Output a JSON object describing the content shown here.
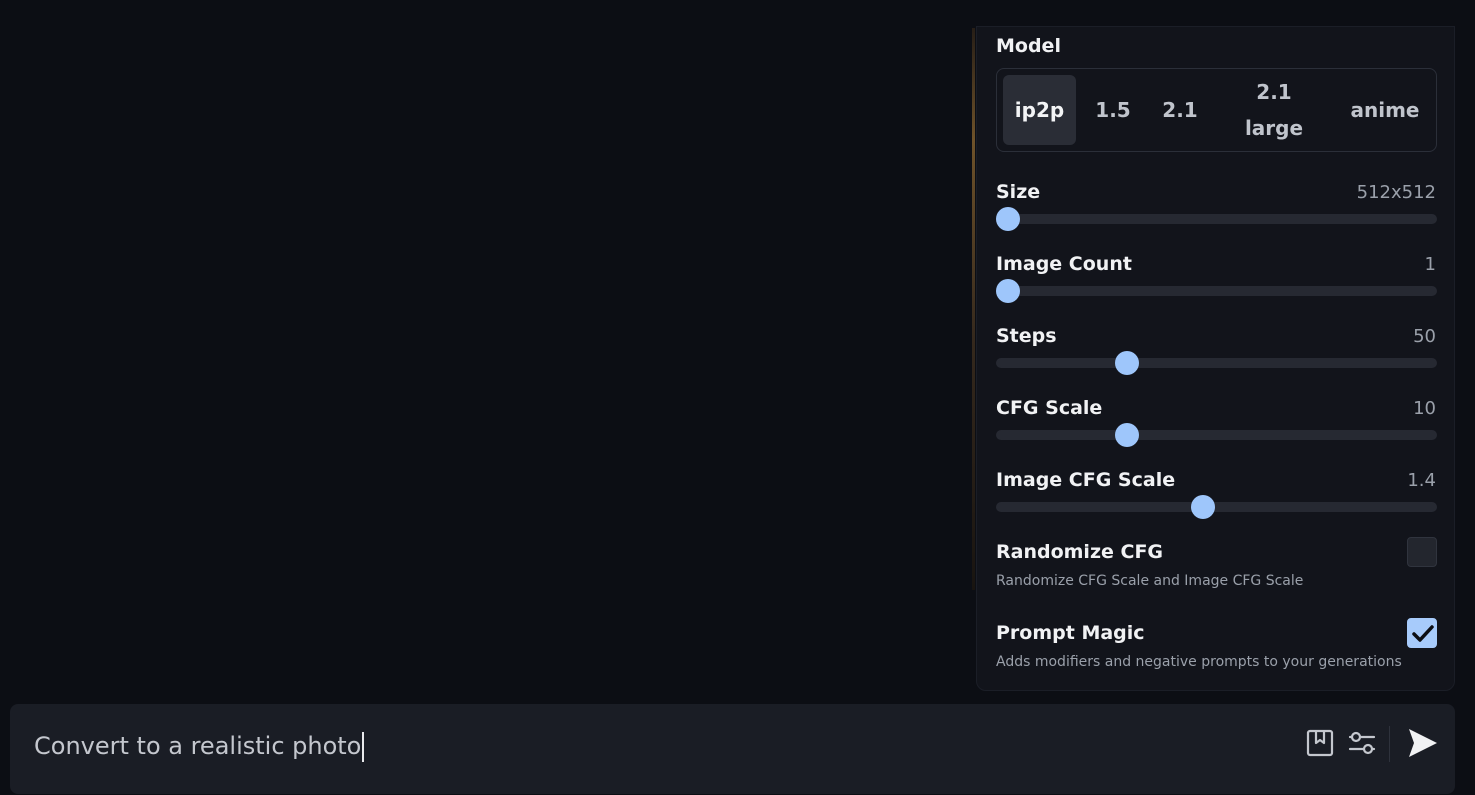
{
  "model": {
    "label": "Model",
    "options": [
      "ip2p",
      "1.5",
      "2.1",
      "2.1 large",
      "anime"
    ],
    "selected": "ip2p"
  },
  "sliders": {
    "size": {
      "label": "Size",
      "value": "512x512",
      "fraction": 0.027
    },
    "image_count": {
      "label": "Image Count",
      "value": "1",
      "fraction": 0.027
    },
    "steps": {
      "label": "Steps",
      "value": "50",
      "fraction": 0.297
    },
    "cfg_scale": {
      "label": "CFG Scale",
      "value": "10",
      "fraction": 0.297
    },
    "image_cfg_scale": {
      "label": "Image CFG Scale",
      "value": "1.4",
      "fraction": 0.469
    }
  },
  "randomize_cfg": {
    "label": "Randomize CFG",
    "description": "Randomize CFG Scale and Image CFG Scale",
    "checked": false
  },
  "prompt_magic": {
    "label": "Prompt Magic",
    "description": "Adds modifiers and negative prompts to your generations",
    "checked": true
  },
  "prompt": {
    "value": "Convert to a realistic photo"
  },
  "icons": {
    "bookmark": "bookmark-icon",
    "settings": "sliders-icon",
    "send": "send-icon"
  },
  "colors": {
    "accent": "#9ec6fb",
    "background": "#0c0e14",
    "panel": "#12141b"
  }
}
